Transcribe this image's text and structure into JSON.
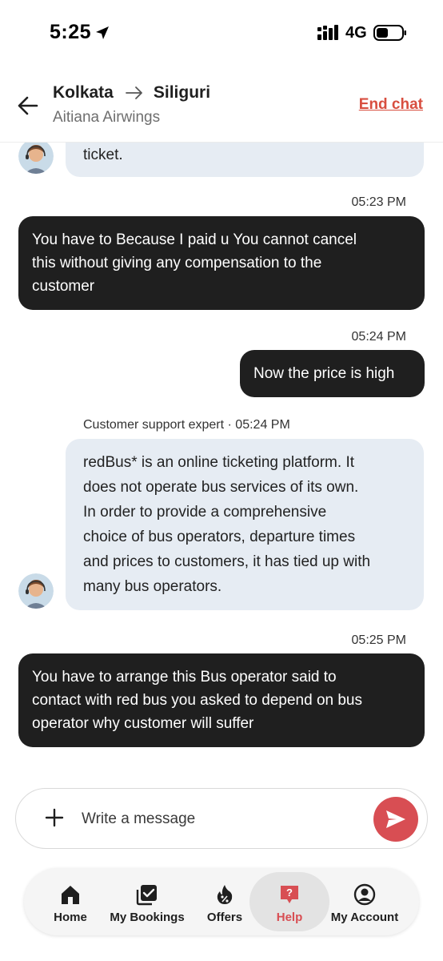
{
  "status_bar": {
    "time": "5:25",
    "network": "4G"
  },
  "header": {
    "origin": "Kolkata",
    "destination": "Siliguri",
    "operator": "Aitiana Airwings",
    "end_chat_label": "End chat"
  },
  "messages": [
    {
      "direction": "in",
      "text": "ticket."
    },
    {
      "direction": "out",
      "time": "05:23 PM",
      "lines": [
        "You have to Because I paid u You cannot cancel",
        "this without giving any compensation to the",
        "customer"
      ]
    },
    {
      "direction": "out",
      "time": "05:24 PM",
      "lines": [
        "Now the price is high"
      ]
    },
    {
      "direction": "in",
      "sender": "Customer support expert · 05:24 PM",
      "lines": [
        "redBus* is an online ticketing platform. It",
        "does not operate bus services of its own.",
        "In order to provide a comprehensive",
        "choice of bus operators, departure times",
        "and prices to customers, it has tied up with",
        "many bus operators."
      ]
    },
    {
      "direction": "out",
      "time": "05:25 PM",
      "lines": [
        "You have to arrange this Bus operator said to",
        "contact with red bus you asked to depend on bus",
        "operator why customer will suffer"
      ]
    }
  ],
  "composer": {
    "placeholder": "Write a message"
  },
  "nav": [
    {
      "label": "Home",
      "icon": "home-icon"
    },
    {
      "label": "My Bookings",
      "icon": "bookings-icon"
    },
    {
      "label": "Offers",
      "icon": "offers-icon"
    },
    {
      "label": "Help",
      "icon": "help-icon",
      "active": true
    },
    {
      "label": "My Account",
      "icon": "account-icon"
    }
  ],
  "colors": {
    "accent": "#d84e53",
    "incoming_bubble": "#e6ecf3",
    "outgoing_bubble": "#1f1f1f"
  }
}
